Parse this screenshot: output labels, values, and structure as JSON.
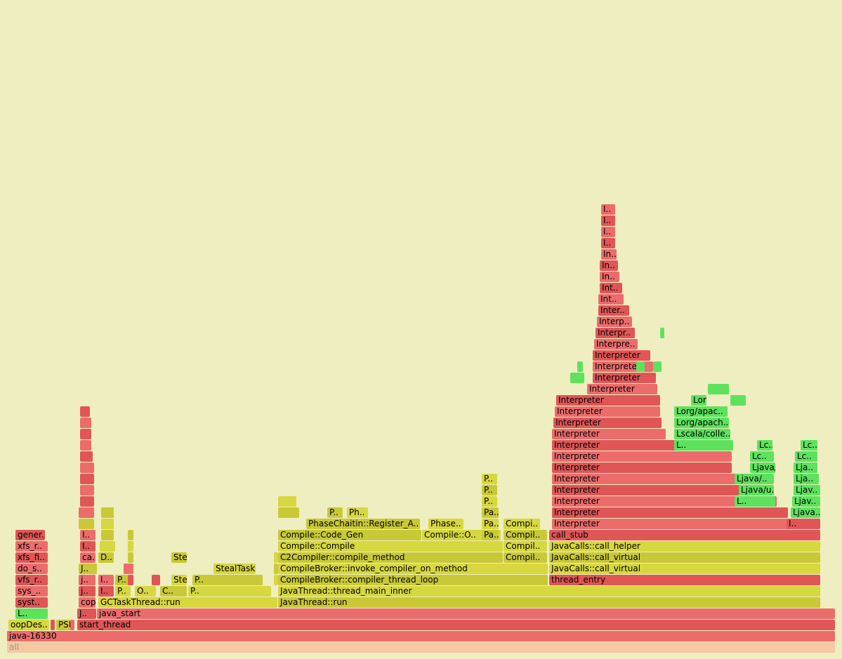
{
  "colors": {
    "background": "#eeeec0",
    "red": "#ec6c6c",
    "red_dark": "#e05656",
    "yellow": "#d7d73f",
    "yellow_dark": "#c9c937",
    "green": "#5ee25e",
    "root": "#f4c8a0"
  },
  "frames": [
    {
      "label": "all",
      "kind": "root"
    },
    {
      "label": "java-16330",
      "kind": "red"
    },
    {
      "label": "start_thread",
      "kind": "red"
    },
    {
      "label": "java_start",
      "kind": "red"
    },
    {
      "label": "J..",
      "kind": "red"
    },
    {
      "label": "GCTaskThread::run",
      "kind": "yellow"
    },
    {
      "label": "JavaThread::run",
      "kind": "yellow"
    },
    {
      "label": "JavaThread::thread_main_inner",
      "kind": "yellow"
    },
    {
      "label": "CompileBroker::compiler_thread_loop",
      "kind": "yellow"
    },
    {
      "label": "CompileBroker::invoke_compiler_on_method",
      "kind": "yellow"
    },
    {
      "label": "C2Compiler::compile_method",
      "kind": "yellow"
    },
    {
      "label": "Compile::Compile",
      "kind": "yellow"
    },
    {
      "label": "Compile::Code_Gen",
      "kind": "yellow"
    },
    {
      "label": "Compile::O..",
      "kind": "yellow"
    },
    {
      "label": "PhaseChaitin::Register_A..",
      "kind": "yellow"
    },
    {
      "label": "Phase..",
      "kind": "yellow"
    },
    {
      "label": "P..",
      "kind": "yellow"
    },
    {
      "label": "Ph..",
      "kind": "yellow"
    },
    {
      "label": "Compil..",
      "kind": "yellow"
    },
    {
      "label": "Compil..",
      "kind": "yellow"
    },
    {
      "label": "Compil..",
      "kind": "yellow"
    },
    {
      "label": "Compi..",
      "kind": "yellow"
    },
    {
      "label": "Pa..",
      "kind": "yellow"
    },
    {
      "label": "Pa..",
      "kind": "yellow"
    },
    {
      "label": "Pa..",
      "kind": "yellow"
    },
    {
      "label": "P..",
      "kind": "yellow"
    },
    {
      "label": "P..",
      "kind": "yellow"
    },
    {
      "label": "P..",
      "kind": "yellow"
    },
    {
      "label": "thread_entry",
      "kind": "red"
    },
    {
      "label": "JavaCalls::call_virtual",
      "kind": "yellow"
    },
    {
      "label": "JavaCalls::call_virtual",
      "kind": "yellow"
    },
    {
      "label": "JavaCalls::call_helper",
      "kind": "yellow"
    },
    {
      "label": "call_stub",
      "kind": "red"
    },
    {
      "label": "Interpreter",
      "kind": "red"
    },
    {
      "label": "Interpreter",
      "kind": "red"
    },
    {
      "label": "Interpreter",
      "kind": "red"
    },
    {
      "label": "Interpreter",
      "kind": "red"
    },
    {
      "label": "Interpreter",
      "kind": "red"
    },
    {
      "label": "Interpreter",
      "kind": "red"
    },
    {
      "label": "Interpreter",
      "kind": "red"
    },
    {
      "label": "Interpreter",
      "kind": "red"
    },
    {
      "label": "Interpreter",
      "kind": "red"
    },
    {
      "label": "Interpreter",
      "kind": "red"
    },
    {
      "label": "Interpreter",
      "kind": "red"
    },
    {
      "label": "Interpreter",
      "kind": "red"
    },
    {
      "label": "Interpreter",
      "kind": "red"
    },
    {
      "label": "Interpreter",
      "kind": "red"
    },
    {
      "label": "Interpreter",
      "kind": "red"
    },
    {
      "label": "Interpreter",
      "kind": "red"
    },
    {
      "label": "Interpre..",
      "kind": "red"
    },
    {
      "label": "Interpr..",
      "kind": "red"
    },
    {
      "label": "Interp..",
      "kind": "red"
    },
    {
      "label": "Inter..",
      "kind": "red"
    },
    {
      "label": "Int..",
      "kind": "red"
    },
    {
      "label": "Int..",
      "kind": "red"
    },
    {
      "label": "In..",
      "kind": "red"
    },
    {
      "label": "In..",
      "kind": "red"
    },
    {
      "label": "In..",
      "kind": "red"
    },
    {
      "label": "I..",
      "kind": "red"
    },
    {
      "label": "I..",
      "kind": "red"
    },
    {
      "label": "I..",
      "kind": "red"
    },
    {
      "label": "I..",
      "kind": "red"
    },
    {
      "label": "I..",
      "kind": "red"
    },
    {
      "label": "Ljava..",
      "kind": "green"
    },
    {
      "label": "Ljav..",
      "kind": "green"
    },
    {
      "label": "Ljav..",
      "kind": "green"
    },
    {
      "label": "Lja..",
      "kind": "green"
    },
    {
      "label": "Lja..",
      "kind": "green"
    },
    {
      "label": "Lc..",
      "kind": "green"
    },
    {
      "label": "Lc..",
      "kind": "green"
    },
    {
      "label": "L..",
      "kind": "green"
    },
    {
      "label": "Ljava/u..",
      "kind": "green"
    },
    {
      "label": "Ljava/..",
      "kind": "green"
    },
    {
      "label": "Ljava/..",
      "kind": "green"
    },
    {
      "label": "Lc..",
      "kind": "green"
    },
    {
      "label": "Lc..",
      "kind": "green"
    },
    {
      "label": "L..",
      "kind": "green"
    },
    {
      "label": "Lscala/colle..",
      "kind": "green"
    },
    {
      "label": "Lorg/apach..",
      "kind": "green"
    },
    {
      "label": "Lorg/apac..",
      "kind": "green"
    },
    {
      "label": "Lorg/apac..",
      "kind": "green"
    },
    {
      "label": "L..",
      "kind": "green"
    },
    {
      "label": "syst..",
      "kind": "red"
    },
    {
      "label": "sys_..",
      "kind": "red"
    },
    {
      "label": "vfs_r..",
      "kind": "red"
    },
    {
      "label": "do_s..",
      "kind": "red"
    },
    {
      "label": "xfs_fi..",
      "kind": "red"
    },
    {
      "label": "xfs_r..",
      "kind": "red"
    },
    {
      "label": "gener..",
      "kind": "red"
    },
    {
      "label": "cop..",
      "kind": "red"
    },
    {
      "label": "j..",
      "kind": "red"
    },
    {
      "label": "j..",
      "kind": "red"
    },
    {
      "label": "J..",
      "kind": "yellow"
    },
    {
      "label": "ca..",
      "kind": "red"
    },
    {
      "label": "I..",
      "kind": "red"
    },
    {
      "label": "I..",
      "kind": "red"
    },
    {
      "label": "I..",
      "kind": "red"
    },
    {
      "label": "I..",
      "kind": "red"
    },
    {
      "label": "D..",
      "kind": "yellow"
    },
    {
      "label": "P..",
      "kind": "yellow"
    },
    {
      "label": "P..",
      "kind": "yellow"
    },
    {
      "label": "O..",
      "kind": "yellow"
    },
    {
      "label": "C..",
      "kind": "yellow"
    },
    {
      "label": "Ste..",
      "kind": "yellow"
    },
    {
      "label": "Stea..",
      "kind": "yellow"
    },
    {
      "label": "P..",
      "kind": "yellow"
    },
    {
      "label": "P..",
      "kind": "yellow"
    },
    {
      "label": "StealTask::do_it",
      "kind": "yellow"
    },
    {
      "label": "PSPromotio..",
      "kind": "yellow"
    },
    {
      "label": "oopDes..",
      "kind": "yellow"
    },
    {
      "label": "",
      "kind": "red"
    },
    {
      "label": "",
      "kind": "red"
    },
    {
      "label": "",
      "kind": "red"
    },
    {
      "label": "",
      "kind": "red"
    },
    {
      "label": "",
      "kind": "yellow"
    },
    {
      "label": "",
      "kind": "yellow"
    },
    {
      "label": "",
      "kind": "yellow"
    },
    {
      "label": "",
      "kind": "yellow"
    },
    {
      "label": "",
      "kind": "yellow"
    },
    {
      "label": "",
      "kind": "yellow"
    },
    {
      "label": "",
      "kind": "yellow"
    },
    {
      "label": "",
      "kind": "yellow"
    },
    {
      "label": "",
      "kind": "yellow"
    },
    {
      "label": "",
      "kind": "yellow"
    },
    {
      "label": "",
      "kind": "yellow"
    },
    {
      "label": "",
      "kind": "yellow"
    },
    {
      "label": "",
      "kind": "yellow"
    },
    {
      "label": "",
      "kind": "red"
    },
    {
      "label": "",
      "kind": "red"
    },
    {
      "label": "",
      "kind": "red"
    },
    {
      "label": "",
      "kind": "red"
    },
    {
      "label": "",
      "kind": "red"
    },
    {
      "label": "",
      "kind": "red"
    },
    {
      "label": "",
      "kind": "red"
    },
    {
      "label": "",
      "kind": "red"
    },
    {
      "label": "",
      "kind": "red"
    },
    {
      "label": "",
      "kind": "red"
    },
    {
      "label": "",
      "kind": "red"
    },
    {
      "label": "",
      "kind": "green"
    },
    {
      "label": "",
      "kind": "green"
    },
    {
      "label": "",
      "kind": "green"
    },
    {
      "label": "",
      "kind": "green"
    },
    {
      "label": "",
      "kind": "green"
    },
    {
      "label": "",
      "kind": "green"
    },
    {
      "label": "",
      "kind": "green"
    },
    {
      "label": "",
      "kind": "red"
    },
    {
      "label": "",
      "kind": "red"
    }
  ]
}
